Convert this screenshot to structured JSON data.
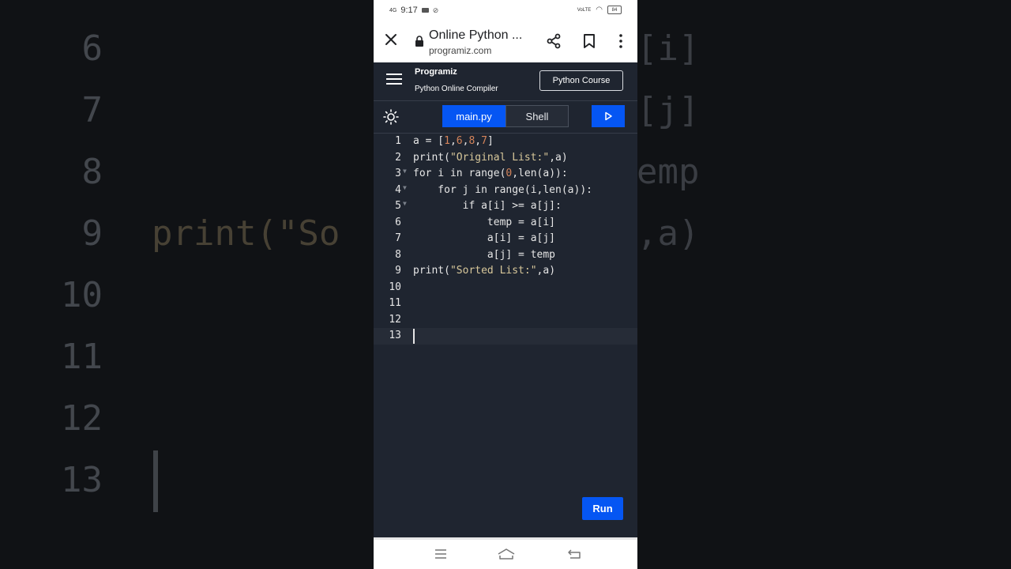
{
  "status_bar": {
    "network": "4G",
    "time": "9:17",
    "right_indicators": "VoLTE",
    "battery": "84"
  },
  "browser": {
    "page_title": "Online Python ...",
    "url": "programiz.com",
    "icons": [
      "close-icon",
      "lock-icon",
      "share-icon",
      "bookmark-icon",
      "more-vert-icon"
    ]
  },
  "app_header": {
    "logo": "Programiz",
    "subtitle": "Python Online Compiler",
    "course_button": "Python Course"
  },
  "toolbar": {
    "tabs": [
      {
        "label": "main.py",
        "active": true
      },
      {
        "label": "Shell",
        "active": false
      }
    ],
    "icons": [
      "sun-icon",
      "play-icon"
    ]
  },
  "editor": {
    "active_line": 13,
    "lines": [
      {
        "num": "1",
        "code": "a = [1,6,8,7]"
      },
      {
        "num": "2",
        "code": "print(\"Original List:\",a)"
      },
      {
        "num": "3",
        "code": "for i in range(0,len(a)):"
      },
      {
        "num": "4",
        "code": "    for j in range(i,len(a)):"
      },
      {
        "num": "5",
        "code": "        if a[i] >= a[j]:"
      },
      {
        "num": "6",
        "code": "            temp = a[i]"
      },
      {
        "num": "7",
        "code": "            a[i] = a[j]"
      },
      {
        "num": "8",
        "code": "            a[j] = temp"
      },
      {
        "num": "9",
        "code": "print(\"Sorted List:\",a)"
      },
      {
        "num": "10",
        "code": ""
      },
      {
        "num": "11",
        "code": ""
      },
      {
        "num": "12",
        "code": ""
      },
      {
        "num": "13",
        "code": ""
      }
    ]
  },
  "run_button": "Run",
  "background_zoom": {
    "line_numbers": [
      "6",
      "7",
      "8",
      "9",
      "10",
      "11",
      "12",
      "13"
    ],
    "code_fragment": "print(\"So",
    "right_fragments": [
      "[i]",
      "[j]",
      "emp",
      ",a)"
    ]
  },
  "colors": {
    "editor_bg": "#1f2530",
    "accent": "#0556f3",
    "string": "#d7c79a",
    "number": "#d4845a"
  },
  "nav_icons": [
    "recent-apps-icon",
    "home-icon",
    "back-icon"
  ]
}
